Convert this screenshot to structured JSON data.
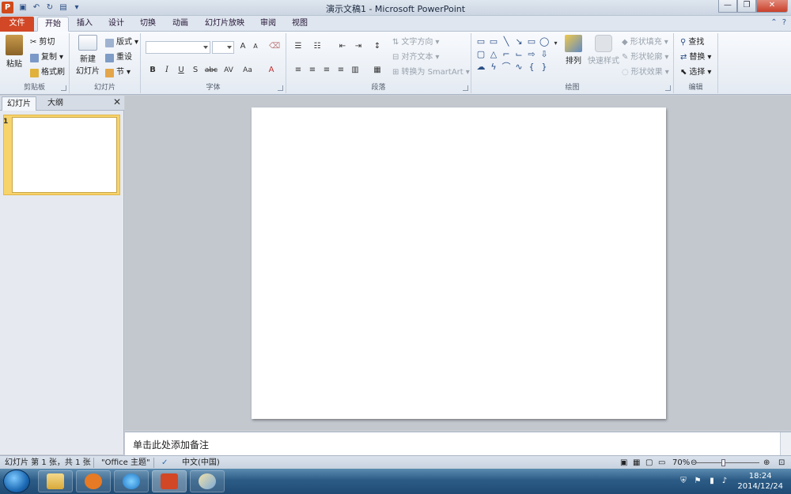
{
  "window": {
    "title": "演示文稿1 - Microsoft PowerPoint",
    "app_badge": "P"
  },
  "tabs": [
    "文件",
    "开始",
    "插入",
    "设计",
    "切换",
    "动画",
    "幻灯片放映",
    "审阅",
    "视图"
  ],
  "ribbon": {
    "clipboard": {
      "label": "剪贴板",
      "paste": "粘贴",
      "cut": "剪切",
      "copy": "复制",
      "format_painter": "格式刷"
    },
    "slides": {
      "label": "幻灯片",
      "new_slide_line1": "新建",
      "new_slide_line2": "幻灯片",
      "layout": "版式",
      "reset": "重设",
      "section": "节"
    },
    "font": {
      "label": "字体",
      "bold": "B",
      "italic": "I",
      "underline": "U",
      "shadow": "S",
      "strike": "abc",
      "spacing": "AV",
      "case": "Aa",
      "color": "A",
      "grow": "A",
      "shrink": "A"
    },
    "paragraph": {
      "label": "段落",
      "text_direction": "文字方向",
      "align_text": "对齐文本",
      "convert_smartart": "转换为 SmartArt"
    },
    "drawing": {
      "label": "绘图",
      "arrange": "排列",
      "quick_styles": "快速样式",
      "shape_fill": "形状填充",
      "shape_outline": "形状轮廓",
      "shape_effects": "形状效果"
    },
    "editing": {
      "label": "编辑",
      "find": "查找",
      "replace": "替换",
      "select": "选择"
    }
  },
  "left_pane": {
    "tab_slides": "幻灯片",
    "tab_outline": "大纲",
    "close": "✕",
    "slide_number": "1"
  },
  "notes": {
    "placeholder": "单击此处添加备注"
  },
  "status": {
    "slide_info": "幻灯片 第 1 张，共 1 张",
    "theme": "\"Office 主题\"",
    "language": "中文(中国)",
    "zoom": "70%"
  },
  "taskbar": {
    "time": "18:24",
    "date": "2014/12/24"
  },
  "colors": {
    "file_tab": "#d24726",
    "selected_thumb": "#f7d36b",
    "ribbon_bg": "#f8fafd"
  }
}
